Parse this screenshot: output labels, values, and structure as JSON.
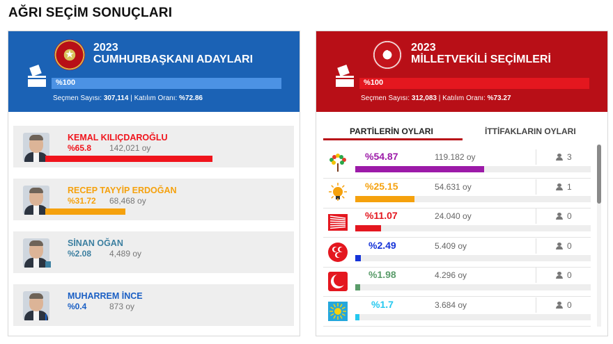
{
  "page_title": "AĞRI SEÇİM SONUÇLARI",
  "president": {
    "year": "2023",
    "title": "CUMHURBAŞKANI ADAYLARI",
    "progress_label": "%100",
    "progress": 1.0,
    "voters_label": "Seçmen Sayısı:",
    "voters": "307,114",
    "turnout_label": "| Katılım Oranı:",
    "turnout": "%72.86",
    "candidates": [
      {
        "name": "KEMAL KILIÇDAROĞLU",
        "pct": "%65.8",
        "votes": "142,021 oy",
        "share": 0.658,
        "color": "#f0141c",
        "icon": "candidate-photo"
      },
      {
        "name": "RECEP TAYYİP ERDOĞAN",
        "pct": "%31.72",
        "votes": "68,468 oy",
        "share": 0.3172,
        "color": "#f5a10d",
        "icon": "candidate-photo"
      },
      {
        "name": "SİNAN OĞAN",
        "pct": "%2.08",
        "votes": "4,489 oy",
        "share": 0.0208,
        "color": "#3c7fa0",
        "icon": "candidate-photo"
      },
      {
        "name": "MUHARREM İNCE",
        "pct": "%0.4",
        "votes": "873 oy",
        "share": 0.004,
        "color": "#1a5fc4",
        "icon": "candidate-photo"
      }
    ]
  },
  "parliament": {
    "year": "2023",
    "title": "MİLLETVEKİLİ SEÇİMLERİ",
    "progress_label": "%100",
    "progress": 1.0,
    "voters_label": "Seçmen Sayısı:",
    "voters": "312,083",
    "turnout_label": "| Katılım Oranı:",
    "turnout": "%73.27",
    "tabs": [
      "PARTİLERİN OYLARI",
      "İTTİFAKLARIN OYLARI"
    ],
    "parties": [
      {
        "pct": "%54.87",
        "votes": "119.182 oy",
        "seats": "3",
        "share": 0.5487,
        "color": "#9c1aa8",
        "icon": "tree-logo-icon"
      },
      {
        "pct": "%25.15",
        "votes": "54.631 oy",
        "seats": "1",
        "share": 0.2515,
        "color": "#f5a10d",
        "icon": "lightbulb-logo-icon"
      },
      {
        "pct": "%11.07",
        "votes": "24.040 oy",
        "seats": "0",
        "share": 0.1107,
        "color": "#e4171f",
        "icon": "six-arrows-logo-icon"
      },
      {
        "pct": "%2.49",
        "votes": "5.409 oy",
        "seats": "0",
        "share": 0.0249,
        "color": "#1533d8",
        "icon": "three-crescents-logo-icon"
      },
      {
        "pct": "%1.98",
        "votes": "4.296 oy",
        "seats": "0",
        "share": 0.0198,
        "color": "#5a9c6a",
        "icon": "crescent-logo-icon"
      },
      {
        "pct": "%1.7",
        "votes": "3.684 oy",
        "seats": "0",
        "share": 0.017,
        "color": "#25c8ef",
        "icon": "sun-logo-icon"
      }
    ]
  }
}
